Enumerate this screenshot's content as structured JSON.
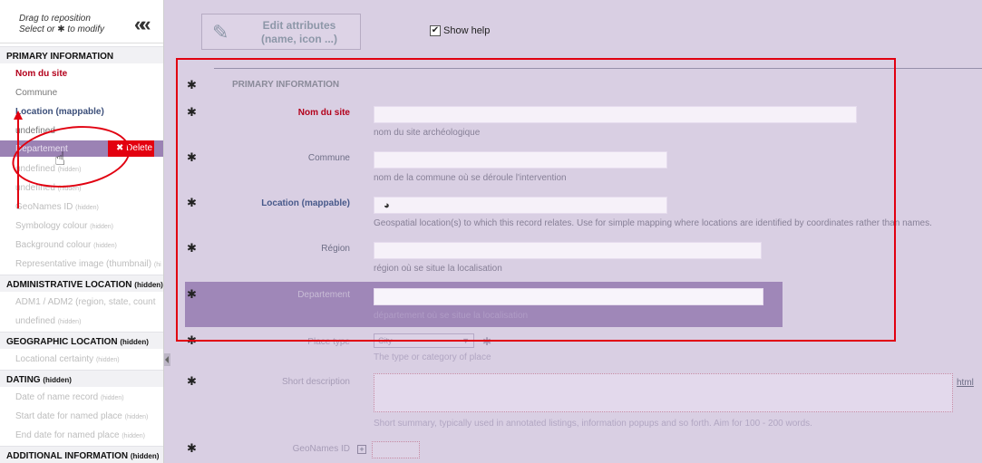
{
  "sidebar": {
    "drag_hint_line1": "Drag to reposition",
    "drag_hint_line2_pre": "Select or",
    "drag_hint_line2_post": "to modify",
    "collapse_glyph": "«",
    "sections": [
      {
        "label": "PRIMARY INFORMATION",
        "suffix": ""
      },
      {
        "label": "ADMINISTRATIVE LOCATION",
        "suffix": "(hidden)"
      },
      {
        "label": "GEOGRAPHIC LOCATION",
        "suffix": "(hidden)"
      },
      {
        "label": "DATING",
        "suffix": "(hidden)"
      },
      {
        "label": "ADDITIONAL INFORMATION",
        "suffix": "(hidden)"
      }
    ],
    "fields": [
      {
        "label": "Nom du site",
        "suffix": ""
      },
      {
        "label": "Commune",
        "suffix": ""
      },
      {
        "label": "Location (mappable)",
        "suffix": ""
      },
      {
        "label": "undefined",
        "suffix": ""
      },
      {
        "label": "Departement",
        "suffix": ""
      },
      {
        "label": "undefined",
        "suffix": "(hidden)"
      },
      {
        "label": "undefined",
        "suffix": "(hidden)"
      },
      {
        "label": "GeoNames ID",
        "suffix": "(hidden)"
      },
      {
        "label": "Symbology colour",
        "suffix": "(hidden)"
      },
      {
        "label": "Background colour",
        "suffix": "(hidden)"
      },
      {
        "label": "Representative image (thumbnail)",
        "suffix": "(hi"
      },
      {
        "label": "ADM1 / ADM2 (region, state, count",
        "suffix": ""
      },
      {
        "label": "undefined",
        "suffix": "(hidden)"
      },
      {
        "label": "Locational certainty",
        "suffix": "(hidden)"
      },
      {
        "label": "Date of name record",
        "suffix": "(hidden)"
      },
      {
        "label": "Start date for named place",
        "suffix": "(hidden)"
      },
      {
        "label": "End date for named place",
        "suffix": "(hidden)"
      }
    ],
    "delete_label": "Delete",
    "delete_glyph": "✖"
  },
  "toolbar": {
    "edit_attributes_line1": "Edit attributes",
    "edit_attributes_line2": "(name, icon ...)",
    "show_help_label": "Show help",
    "show_help_checked": "✔"
  },
  "form": {
    "section_title": "PRIMARY INFORMATION",
    "fields": [
      {
        "label": "Nom du site",
        "help": "nom du site archéologique"
      },
      {
        "label": "Commune",
        "help": "nom de la commune où se déroule l'intervention"
      },
      {
        "label": "Location (mappable)",
        "help": "Geospatial location(s) to which this record relates. Use for simple mapping where locations are identified by coordinates rather than names."
      },
      {
        "label": "Région",
        "help": "région où se situe la localisation"
      },
      {
        "label": "Departement",
        "help": "département où se situe la localisation"
      },
      {
        "label": "Place type",
        "help": "The type or category of place",
        "value": "City"
      },
      {
        "label": "Short description",
        "help": "Short summary, typically used in annotated listings, information popups and so forth. Aim for 100 - 200 words."
      },
      {
        "label": "GeoNames ID",
        "help": ""
      }
    ],
    "html_link": "html",
    "gear_glyph": "✱",
    "globe_glyph": "◕",
    "plus_glyph": "+"
  },
  "colors": {
    "accent_red": "#b3001b",
    "highlight_purple": "#9b82b4",
    "annotation_red": "#e10010"
  }
}
